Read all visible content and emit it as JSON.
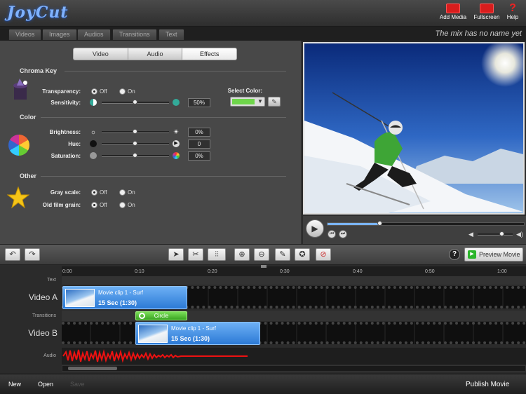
{
  "app": {
    "logo_text": "JoyCut"
  },
  "top_actions": [
    {
      "label": "Add Media",
      "icon": "add-media-icon"
    },
    {
      "label": "Fullscreen",
      "icon": "fullscreen-icon"
    },
    {
      "label": "Help",
      "icon": "help-icon"
    }
  ],
  "tabs": [
    "Videos",
    "Images",
    "Audios",
    "Transitions",
    "Text"
  ],
  "mix_name": "The mix has no name yet",
  "panel_tabs": [
    "Video",
    "Audio",
    "Effects"
  ],
  "panel_tabs_selected": "Effects",
  "chroma_key": {
    "title": "Chroma Key",
    "transparency_label": "Transparency:",
    "off_label": "Off",
    "on_label": "On",
    "transparency_selected": "Off",
    "sensitivity_label": "Sensitivity:",
    "sensitivity_value": "50%",
    "sensitivity_level": 0.5,
    "select_color_label": "Select Color:",
    "selected_color": "#6ed54a"
  },
  "color": {
    "title": "Color",
    "brightness_label": "Brightness:",
    "brightness_value": "0%",
    "hue_label": "Hue:",
    "hue_value": "0",
    "saturation_label": "Saturation:",
    "saturation_value": "0%"
  },
  "other": {
    "title": "Other",
    "grayscale_label": "Gray scale:",
    "grayscale_off": "Off",
    "grayscale_on": "On",
    "filmgrain_label": "Old film grain:",
    "filmgrain_off": "Off",
    "filmgrain_on": "On"
  },
  "playback": {
    "progress": 0.27,
    "volume": 0.7
  },
  "toolbar": {
    "preview_label": "Preview Movie"
  },
  "ruler_ticks": [
    "0:00",
    "0:10",
    "0:20",
    "0:30",
    "0:40",
    "0:50",
    "1:00"
  ],
  "tracks": {
    "text_label": "Text",
    "video_a_label": "Video A",
    "transitions_label": "Transitions",
    "video_b_label": "Video B",
    "audio_label": "Audio"
  },
  "clips": {
    "a_title": "Movie clip 1 - Surf",
    "a_duration": "15 Sec (1:30)",
    "b_title": "Movie clip 1 - Surf",
    "b_duration": "15 Sec (1:30)",
    "transition_label": "Circle"
  },
  "bottom": {
    "new_label": "New",
    "open_label": "Open",
    "save_label": "Save",
    "publish_label": "Publish Movie"
  }
}
